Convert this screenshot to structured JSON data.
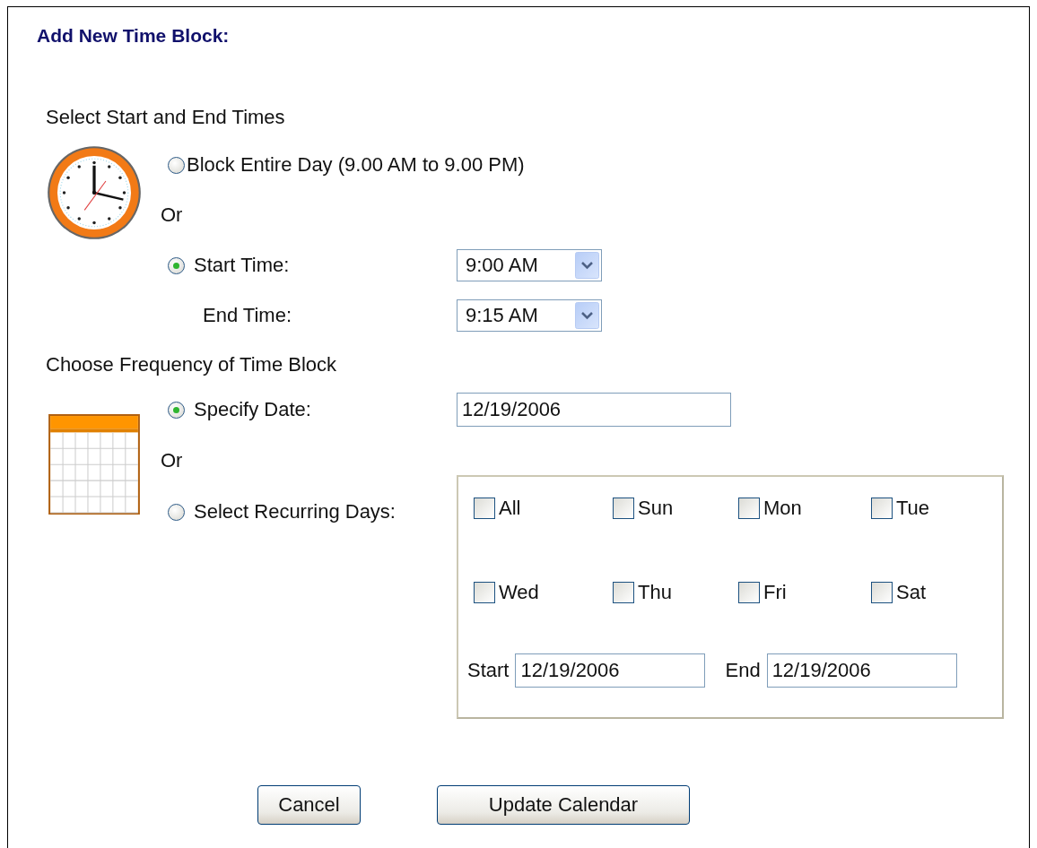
{
  "title": "Add New Time Block:",
  "sections": [
    {
      "kind": "times",
      "heading": "Select Start and End Times",
      "rows": [
        {
          "kind": "radio",
          "label": "Block Entire Day (9.00 AM to 9.00 PM)",
          "selected": false
        },
        {
          "kind": "or",
          "label": "Or"
        },
        {
          "kind": "radio-select",
          "label": "Start Time:",
          "selected": true,
          "value": "9:00 AM"
        },
        {
          "kind": "label-select",
          "label": "End Time:",
          "value": "9:15 AM"
        }
      ]
    },
    {
      "kind": "frequency",
      "heading": "Choose Frequency of Time Block",
      "rows": [
        {
          "kind": "radio-input",
          "label": "Specify Date:",
          "selected": true,
          "value": "12/19/2006"
        },
        {
          "kind": "or",
          "label": "Or"
        },
        {
          "kind": "radio-recurring",
          "label": "Select Recurring Days:",
          "selected": false,
          "days": [
            {
              "label": "All",
              "checked": false
            },
            {
              "label": "Sun",
              "checked": false
            },
            {
              "label": "Mon",
              "checked": false
            },
            {
              "label": "Tue",
              "checked": false
            },
            {
              "label": "Wed",
              "checked": false
            },
            {
              "label": "Thu",
              "checked": false
            },
            {
              "label": "Fri",
              "checked": false
            },
            {
              "label": "Sat",
              "checked": false
            }
          ],
          "start_label": "Start",
          "start_value": "12/19/2006",
          "end_label": "End",
          "end_value": "12/19/2006"
        }
      ]
    }
  ],
  "buttons": [
    {
      "kind": "cancel",
      "label": "Cancel"
    },
    {
      "kind": "submit",
      "label": "Update Calendar"
    }
  ]
}
